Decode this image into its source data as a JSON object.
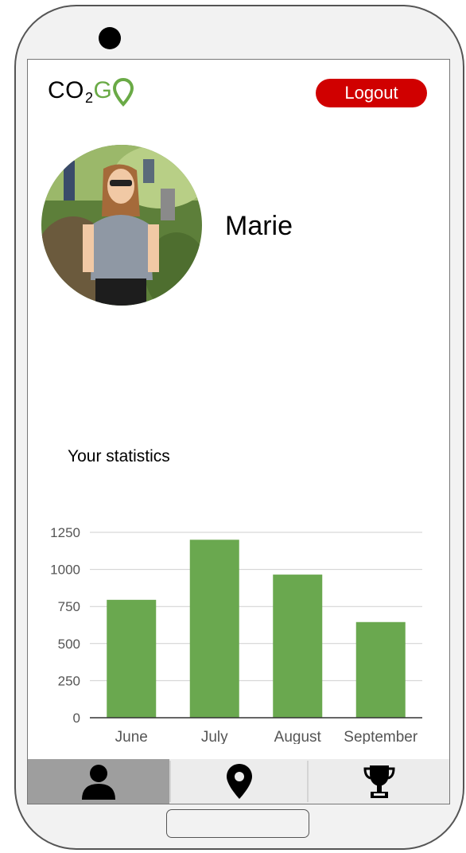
{
  "header": {
    "logo": {
      "co": "CO",
      "sub": "2",
      "go_letter": "G",
      "pin_icon": "map-pin-icon"
    },
    "logout_label": "Logout"
  },
  "profile": {
    "name": "Marie",
    "avatar_icon": "profile-photo"
  },
  "stats": {
    "title": "Your statistics"
  },
  "chart_data": {
    "type": "bar",
    "categories": [
      "June",
      "July",
      "August",
      "September"
    ],
    "values": [
      795,
      1200,
      965,
      645
    ],
    "ylim": [
      0,
      1250
    ],
    "yticks": [
      0,
      250,
      500,
      750,
      1000,
      1250
    ],
    "grid": true,
    "xlabel": "",
    "ylabel": "",
    "title": "",
    "color": "#6aa84f"
  },
  "tabbar": {
    "items": [
      {
        "icon": "person-icon",
        "active": true
      },
      {
        "icon": "map-pin-icon",
        "active": false
      },
      {
        "icon": "trophy-icon",
        "active": false
      }
    ]
  },
  "colors": {
    "accent": "#6aaa46",
    "logout": "#d00000",
    "bar": "#6aa84f",
    "active_tab": "#9e9e9e"
  }
}
